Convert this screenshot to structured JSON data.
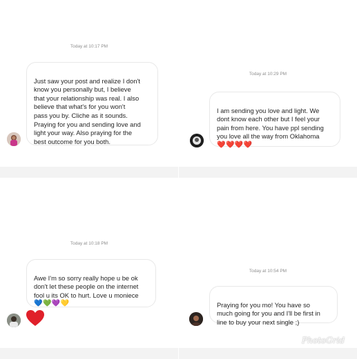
{
  "colors": {
    "bubble_border": "#e8e8e8",
    "timestamp": "#8e8e8e",
    "text": "#262626",
    "heart_red": "#e0202a",
    "footer_gray": "#f3f3f3"
  },
  "panels": [
    {
      "timestamp": "Today at 10:17 PM",
      "message": "Just saw your post and realize I don't\nknow you personally but, I believe\nthat your relationship was real. I also\nbelieve that what's for you won't\npass you by. Cliche as it sounds.\nPraying for you and sending love and\nlight your way. Also praying for the\nbest outcome for you both.",
      "avatar_icon": "profile-avatar"
    },
    {
      "timestamp": "Today at 10:29 PM",
      "message": "I am sending you love and light. We\ndont know each other but I feel your\npain from here. You have ppl sending\nyou love all the way from Oklahoma",
      "emoji": "❤️❤️❤️❤️",
      "avatar_icon": "profile-avatar"
    },
    {
      "timestamp": "Today at 10:18 PM",
      "message": "Awe I'm so sorry really hope u be ok\ndon't let these people on the internet\nfool u its OK to hurt. Love u moniece",
      "emoji": "💙💚💜💛",
      "reaction": "heart-reaction",
      "avatar_icon": "profile-avatar"
    },
    {
      "timestamp": "Today at 10:54 PM",
      "message": "Praying for you mo! You have so\nmuch going for you and I'll be first in\nline to buy your next single ;)",
      "avatar_icon": "profile-avatar"
    }
  ],
  "watermark": "PhotoGrid"
}
